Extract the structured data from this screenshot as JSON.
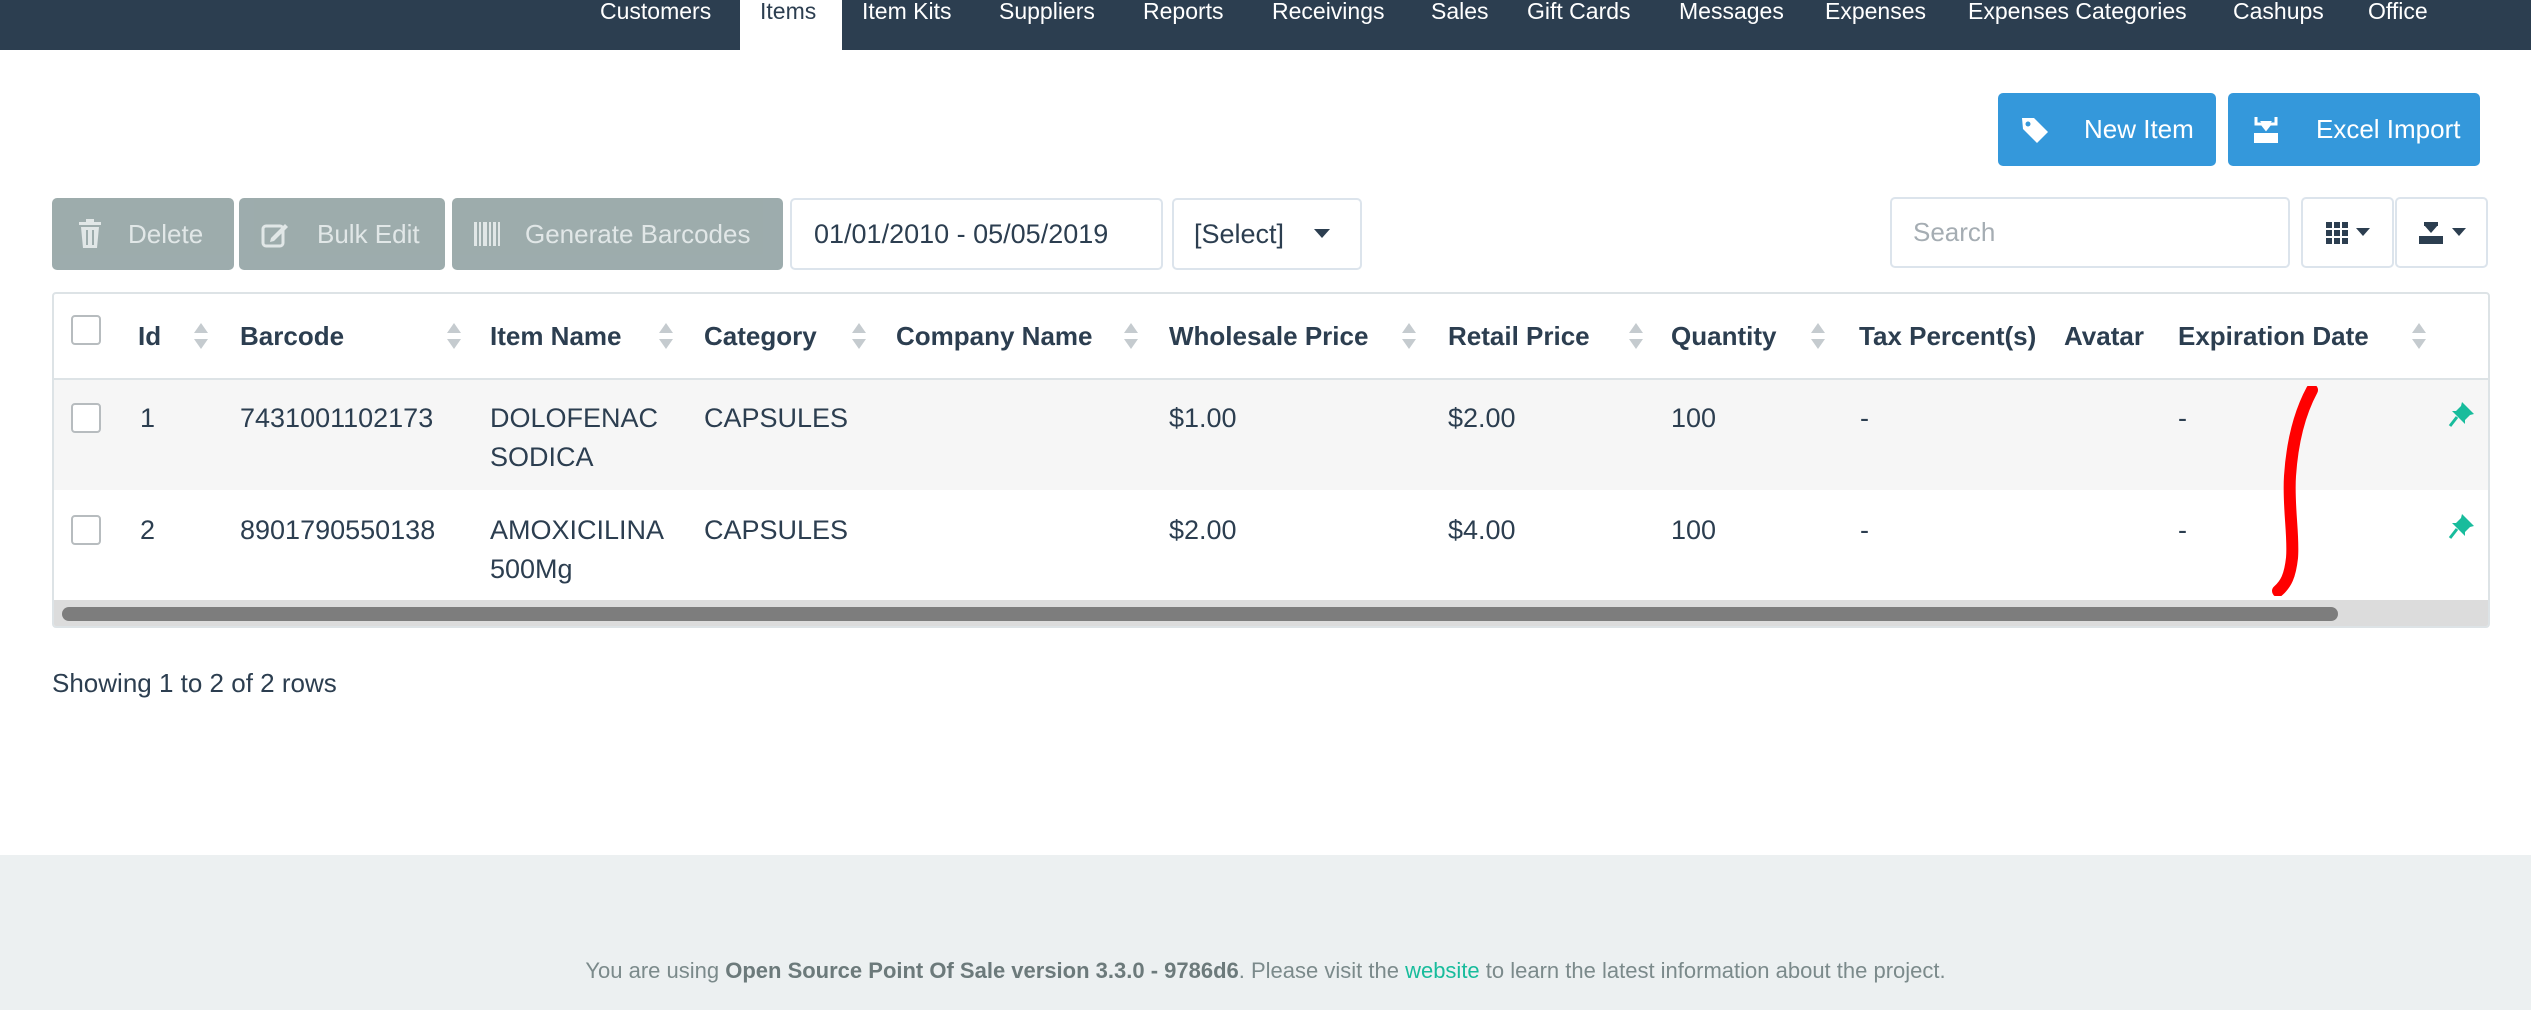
{
  "nav": {
    "items": [
      {
        "label": "Customers",
        "active": false
      },
      {
        "label": "Items",
        "active": true
      },
      {
        "label": "Item Kits",
        "active": false
      },
      {
        "label": "Suppliers",
        "active": false
      },
      {
        "label": "Reports",
        "active": false
      },
      {
        "label": "Receivings",
        "active": false
      },
      {
        "label": "Sales",
        "active": false
      },
      {
        "label": "Gift Cards",
        "active": false
      },
      {
        "label": "Messages",
        "active": false
      },
      {
        "label": "Expenses",
        "active": false
      },
      {
        "label": "Expenses Categories",
        "active": false
      },
      {
        "label": "Cashups",
        "active": false
      },
      {
        "label": "Office",
        "active": false
      }
    ]
  },
  "actions": {
    "new_item": "New Item",
    "excel_import": "Excel Import"
  },
  "toolbar": {
    "delete": "Delete",
    "bulk_edit": "Bulk Edit",
    "generate_barcodes": "Generate Barcodes",
    "date_range": "01/01/2010 - 05/05/2019",
    "filter_select": "[Select]",
    "search_placeholder": "Search"
  },
  "table": {
    "columns": [
      "Id",
      "Barcode",
      "Item Name",
      "Category",
      "Company Name",
      "Wholesale Price",
      "Retail Price",
      "Quantity",
      "Tax Percent(s)",
      "Avatar",
      "Expiration Date"
    ],
    "rows": [
      {
        "id": "1",
        "barcode": "7431001102173",
        "name_line1": "DOLOFENAC",
        "name_line2": "SODICA",
        "category": "CAPSULES",
        "company": "",
        "wholesale": "$1.00",
        "retail": "$2.00",
        "quantity": "100",
        "tax": "-",
        "avatar": "",
        "expiration": "-"
      },
      {
        "id": "2",
        "barcode": "8901790550138",
        "name_line1": "AMOXICILINA",
        "name_line2": "500Mg",
        "category": "CAPSULES",
        "company": "",
        "wholesale": "$2.00",
        "retail": "$4.00",
        "quantity": "100",
        "tax": "-",
        "avatar": "",
        "expiration": "-"
      }
    ]
  },
  "pagination": {
    "summary": "Showing 1 to 2 of 2 rows"
  },
  "footer": {
    "prefix": "You are using ",
    "product": "Open Source Point Of Sale version 3.3.0 - 9786d6",
    "middle": ". Please visit the ",
    "link": "website",
    "suffix": " to learn the latest information about the project."
  },
  "colors": {
    "navbar": "#2c3e50",
    "primary": "#3498db",
    "disabled_button": "#95a5a6",
    "accent": "#18bc9c",
    "annotation": "#ff0000"
  }
}
